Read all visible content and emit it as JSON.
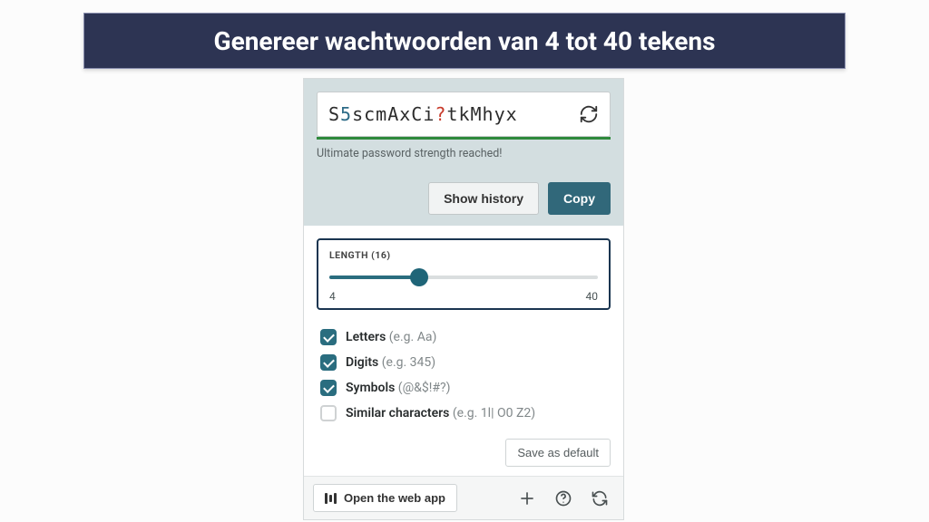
{
  "banner": {
    "title": "Genereer wachtwoorden van 4 tot 40 tekens"
  },
  "password": {
    "value_parts": [
      {
        "t": "S",
        "c": "l"
      },
      {
        "t": "5",
        "c": "n"
      },
      {
        "t": "scmAxCi",
        "c": "l"
      },
      {
        "t": "?",
        "c": "s"
      },
      {
        "t": "tkMhyx",
        "c": "l"
      }
    ],
    "strength_text": "Ultimate password strength reached!"
  },
  "actions": {
    "show_history": "Show history",
    "copy": "Copy"
  },
  "length": {
    "label": "LENGTH (16)",
    "value": 16,
    "min": 4,
    "max": 40
  },
  "options": [
    {
      "key": "letters",
      "label": "Letters",
      "hint": "(e.g. Aa)",
      "checked": true
    },
    {
      "key": "digits",
      "label": "Digits",
      "hint": "(e.g. 345)",
      "checked": true
    },
    {
      "key": "symbols",
      "label": "Symbols",
      "hint": "(@&$!#?)",
      "checked": true
    },
    {
      "key": "similar",
      "label": "Similar characters",
      "hint": "(e.g. 1l| O0 Z2)",
      "checked": false
    }
  ],
  "save_default": "Save as default",
  "footer": {
    "open_app": "Open the web app"
  }
}
